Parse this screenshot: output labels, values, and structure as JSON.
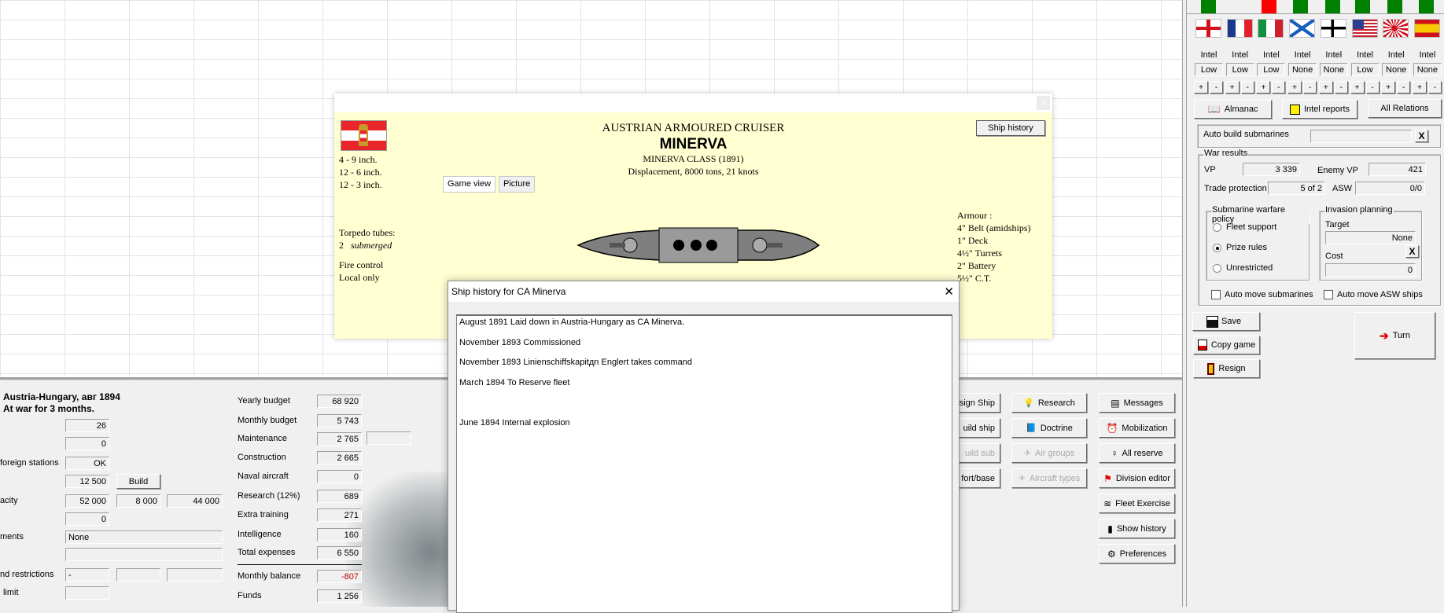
{
  "ship_card": {
    "close_label": "x",
    "nation_type": "AUSTRIAN ARMOURED CRUISER",
    "name": "MINERVA",
    "class": "MINERVA CLASS (1891)",
    "displacement": "Displacement, 8000 tons, 21 knots",
    "guns": [
      "4 - 9 inch.",
      "12 - 6 inch.",
      "12 - 3 inch."
    ],
    "ship_history_label": "Ship history",
    "tabs": [
      "Game view",
      "Picture"
    ],
    "torpedo_label": "Torpedo tubes:",
    "torpedo_count": "2",
    "torpedo_type": "submerged",
    "fire_control_label": "Fire control",
    "fire_control_value": "Local only",
    "armour_label": "Armour :",
    "armour": [
      "4\" Belt (amidships)",
      "1\" Deck",
      "4½\" Turrets",
      "2\" Battery",
      "5½\" C.T."
    ]
  },
  "history_dialog": {
    "title": "Ship history for CA Minerva",
    "close_label": "✕",
    "entries": [
      "August 1891 Laid down in Austria-Hungary as CA Minerva.",
      "November 1893 Commissioned",
      "November 1893 Linienschiffskapitдn Englert takes command",
      "March 1894 To Reserve fleet",
      "",
      "June 1894 Internal explosion"
    ]
  },
  "status": {
    "title": "Austria-Hungary, авг 1894",
    "subtitle": "At war for 3 months.",
    "row1_value": "26",
    "row2_value": "0",
    "foreign_label": "foreign stations",
    "foreign_value": "OK",
    "row4_value": "12 500",
    "build_label": "Build",
    "capacity_label": "acity",
    "capacity_values": [
      "52 000",
      "8 000",
      "44 000"
    ],
    "row6_value": "0",
    "ments_label": "ments",
    "ments_value": "None",
    "restrictions_label": "nd restrictions",
    "restrictions_value": "-",
    "limit_label": "limit"
  },
  "budget": {
    "rows": [
      {
        "label": "Yearly budget",
        "value": "68 920"
      },
      {
        "label": "Monthly budget",
        "value": "5 743"
      },
      {
        "label": "Maintenance",
        "value": "2 765"
      },
      {
        "label": "Construction",
        "value": "2 665"
      },
      {
        "label": "Naval aircraft",
        "value": "0"
      },
      {
        "label": "Research (12%)",
        "value": "689"
      },
      {
        "label": "Extra training",
        "value": "271"
      },
      {
        "label": "Intelligence",
        "value": "160"
      },
      {
        "label": "Total expenses",
        "value": "6 550"
      }
    ],
    "balance_label": "Monthly balance",
    "balance_value": "-807",
    "balance_color": "#c00000",
    "funds_label": "Funds",
    "funds_value": "1 256"
  },
  "actions": {
    "col1": [
      "sign Ship",
      "uild ship",
      "uild sub",
      "l fort/base"
    ],
    "col2": [
      "Research",
      "Doctrine",
      "Air groups",
      "Aircraft types"
    ],
    "col3": [
      "Messages",
      "Mobilization",
      "All reserve",
      "Division editor",
      "Fleet Exercise",
      "Show history",
      "Preferences"
    ]
  },
  "right_panel": {
    "indicator_colors": [
      "#008000",
      "#ff0000",
      "#008000",
      "#008000",
      "#008000",
      "#008000",
      "#008000"
    ],
    "nations": [
      {
        "flag": "uk-flag",
        "intel_label": "Intel",
        "intel": "Low"
      },
      {
        "flag": "france-flag",
        "intel_label": "Intel",
        "intel": "Low"
      },
      {
        "flag": "italy-flag",
        "intel_label": "Intel",
        "intel": "Low"
      },
      {
        "flag": "russia-flag",
        "intel_label": "Intel",
        "intel": "None"
      },
      {
        "flag": "germany-flag",
        "intel_label": "Intel",
        "intel": "None"
      },
      {
        "flag": "usa-flag",
        "intel_label": "Intel",
        "intel": "Low"
      },
      {
        "flag": "japan-flag",
        "intel_label": "Intel",
        "intel": "None"
      },
      {
        "flag": "spain-flag",
        "intel_label": "Intel",
        "intel": "None"
      }
    ],
    "plus": "+",
    "minus": "-",
    "almanac": "Almanac",
    "intel_reports": "Intel reports",
    "all_relations": "All Relations",
    "auto_build_subs": "Auto build submarines",
    "x_label": "X",
    "war_results": "War results",
    "vp_label": "VP",
    "vp_value": "3 339",
    "enemy_vp_label": "Enemy VP",
    "enemy_vp_value": "421",
    "trade_label": "Trade protection",
    "trade_value": "5 of 2",
    "asw_label": "ASW",
    "asw_value": "0/0",
    "sub_policy": "Submarine warfare policy",
    "policy_options": [
      "Fleet support",
      "Prize rules",
      "Unrestricted"
    ],
    "policy_selected": "Prize rules",
    "invasion": "Invasion planning",
    "target_label": "Target",
    "target_value": "None",
    "cost_label": "Cost",
    "cost_value": "0",
    "auto_move_subs": "Auto move submarines",
    "auto_move_asw": "Auto move ASW ships",
    "save": "Save",
    "copy_game": "Copy game",
    "resign": "Resign",
    "turn": "Turn"
  }
}
